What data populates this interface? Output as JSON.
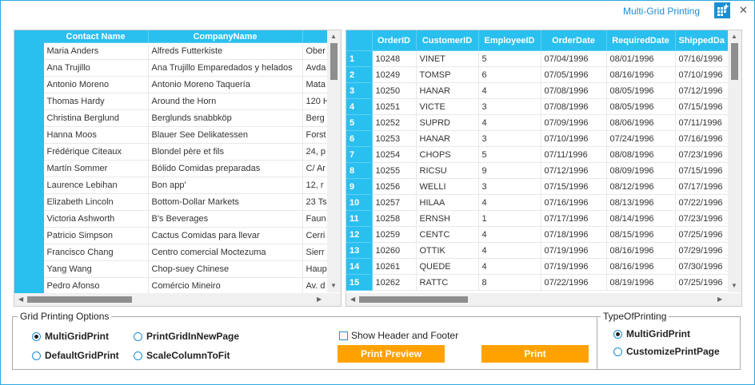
{
  "window": {
    "title": "Multi-Grid Printing",
    "accent": "#1a8fd3",
    "header_color": "#29c0ef",
    "button_color": "#ffa200"
  },
  "grid1": {
    "columns": [
      "Contact Name",
      "CompanyName",
      ""
    ],
    "rows": [
      [
        "Maria Anders",
        "Alfreds Futterkiste",
        "Ober"
      ],
      [
        "Ana Trujillo",
        "Ana Trujillo Emparedados y helados",
        "Avda"
      ],
      [
        "Antonio Moreno",
        "Antonio Moreno Taquería",
        "Mata"
      ],
      [
        "Thomas Hardy",
        "Around the Horn",
        "120 H"
      ],
      [
        "Christina Berglund",
        "Berglunds snabbköp",
        "Berg"
      ],
      [
        "Hanna Moos",
        "Blauer See Delikatessen",
        "Forst"
      ],
      [
        "Frédérique Citeaux",
        "Blondel père et fils",
        "24, p"
      ],
      [
        "Martín Sommer",
        "Bólido Comidas preparadas",
        "C/ Ar"
      ],
      [
        "Laurence Lebihan",
        "Bon app'",
        "12, r"
      ],
      [
        "Elizabeth Lincoln",
        "Bottom-Dollar Markets",
        "23 Ts"
      ],
      [
        "Victoria Ashworth",
        "B's Beverages",
        "Faun"
      ],
      [
        "Patricio Simpson",
        "Cactus Comidas para llevar",
        "Cerri"
      ],
      [
        "Francisco Chang",
        "Centro comercial Moctezuma",
        "Sierr"
      ],
      [
        "Yang Wang",
        "Chop-suey Chinese",
        "Haup"
      ],
      [
        "Pedro Afonso",
        "Comércio Mineiro",
        "Av. d"
      ]
    ]
  },
  "grid2": {
    "columns": [
      "OrderID",
      "CustomerID",
      "EmployeeID",
      "OrderDate",
      "RequiredDate",
      "ShippedDa"
    ],
    "rows": [
      [
        "1",
        "10248",
        "VINET",
        "5",
        "07/04/1996",
        "08/01/1996",
        "07/16/1996"
      ],
      [
        "2",
        "10249",
        "TOMSP",
        "6",
        "07/05/1996",
        "08/16/1996",
        "07/10/1996"
      ],
      [
        "3",
        "10250",
        "HANAR",
        "4",
        "07/08/1996",
        "08/05/1996",
        "07/12/1996"
      ],
      [
        "4",
        "10251",
        "VICTE",
        "3",
        "07/08/1996",
        "08/05/1996",
        "07/15/1996"
      ],
      [
        "5",
        "10252",
        "SUPRD",
        "4",
        "07/09/1996",
        "08/06/1996",
        "07/11/1996"
      ],
      [
        "6",
        "10253",
        "HANAR",
        "3",
        "07/10/1996",
        "07/24/1996",
        "07/16/1996"
      ],
      [
        "7",
        "10254",
        "CHOPS",
        "5",
        "07/11/1996",
        "08/08/1996",
        "07/23/1996"
      ],
      [
        "8",
        "10255",
        "RICSU",
        "9",
        "07/12/1996",
        "08/09/1996",
        "07/15/1996"
      ],
      [
        "9",
        "10256",
        "WELLI",
        "3",
        "07/15/1996",
        "08/12/1996",
        "07/17/1996"
      ],
      [
        "10",
        "10257",
        "HILAA",
        "4",
        "07/16/1996",
        "08/13/1996",
        "07/22/1996"
      ],
      [
        "11",
        "10258",
        "ERNSH",
        "1",
        "07/17/1996",
        "08/14/1996",
        "07/23/1996"
      ],
      [
        "12",
        "10259",
        "CENTC",
        "4",
        "07/18/1996",
        "08/15/1996",
        "07/25/1996"
      ],
      [
        "13",
        "10260",
        "OTTIK",
        "4",
        "07/19/1996",
        "08/16/1996",
        "07/29/1996"
      ],
      [
        "14",
        "10261",
        "QUEDE",
        "4",
        "07/19/1996",
        "08/16/1996",
        "07/30/1996"
      ],
      [
        "15",
        "10262",
        "RATTC",
        "8",
        "07/22/1996",
        "08/19/1996",
        "07/25/1996"
      ]
    ]
  },
  "options": {
    "title": "Grid Printing Options",
    "multi": "MultiGridPrint",
    "newpage": "PrintGridInNewPage",
    "default": "DefaultGridPrint",
    "scale": "ScaleColumnToFit",
    "show_header_footer": "Show Header and Footer",
    "print_preview": "Print Preview",
    "print": "Print"
  },
  "type": {
    "title": "TypeOfPrinting",
    "multi": "MultiGridPrint",
    "custom": "CustomizePrintPage"
  }
}
